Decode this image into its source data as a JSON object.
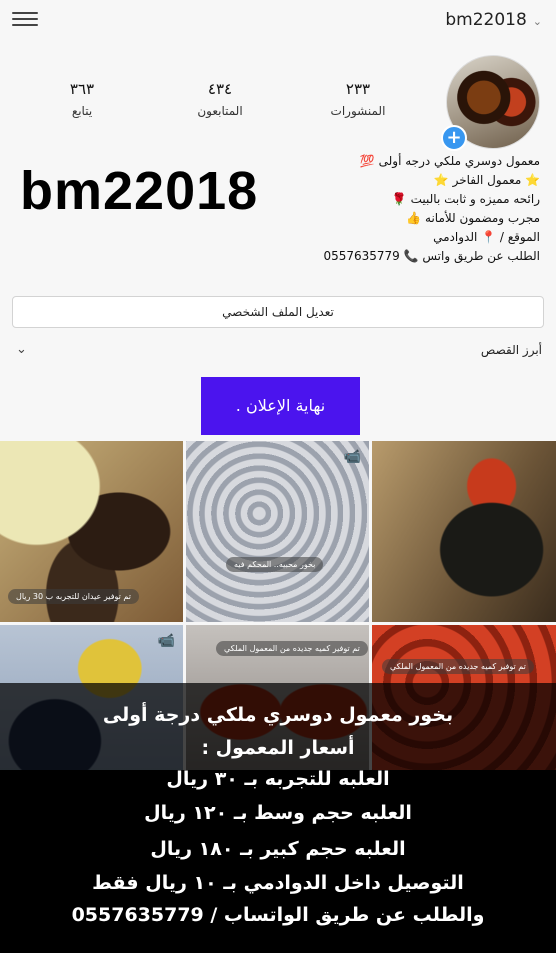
{
  "header": {
    "username": "bm22018",
    "chevron": "⌄",
    "menu_icon": "hamburger-icon"
  },
  "stats": [
    {
      "number": "٢٣٣",
      "label": "المنشورات"
    },
    {
      "number": "٤٣٤",
      "label": "المتابعون"
    },
    {
      "number": "٣٦٣",
      "label": "يتابع"
    }
  ],
  "profile": {
    "big_name": "bm22018",
    "bio_lines": [
      "معمول دوسري ملكي درجه أولى 💯",
      "⭐ معمول الفاخر ⭐",
      "رائحه مميزه و ثابت بالبيت 🌹",
      "مجرب ومضمون للأمانه 👍",
      "الموقع / 📍 الدوادمي",
      "الطلب عن طريق واتس 📞 0557635779"
    ]
  },
  "buttons": {
    "edit_profile": "تعديل الملف الشخصي",
    "highlights": "أبرز القصص"
  },
  "ad": {
    "text": "نهاية الإعلان ."
  },
  "grid": {
    "captions": [
      "تم توفير عيدان للتجربه ب 30 ريال",
      "بخور محبيه.. المحكم فيه",
      "",
      "",
      "تم توفير كميه جديده من المعمول الملكي",
      "تم توفير كميه جديده من المعمول الملكي"
    ]
  },
  "overlay": {
    "lines": [
      "بخور معمول دوسري ملكي درجة أولى",
      "أسعار المعمول :",
      "العلبه للتجربه بـ ٣٠ ريال",
      "العلبه حجم وسط بـ ١٢٠ ريال",
      "العلبه حجم كبير بـ ١٨٠ ريال",
      "التوصيل داخل الدوادمي بـ ١٠ ريال فقط",
      "والطلب عن طريق الواتساب / 0557635779"
    ]
  }
}
